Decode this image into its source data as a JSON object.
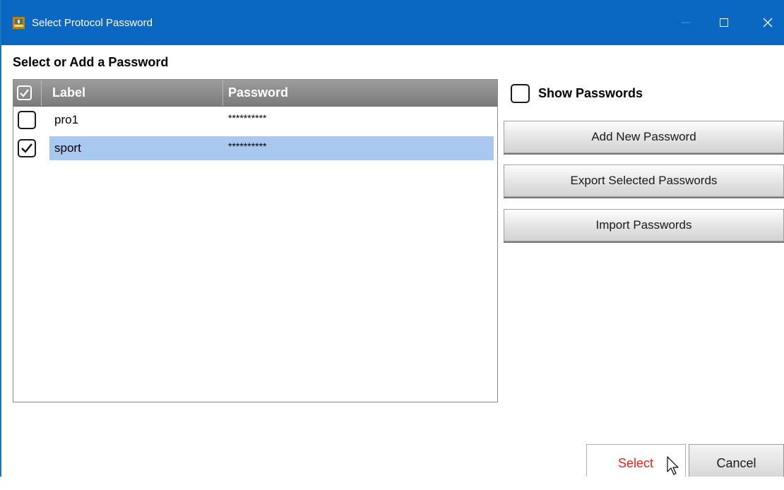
{
  "window": {
    "title": "Select Protocol Password",
    "title_icon": "app-icon",
    "controls": [
      "minimize-icon",
      "maximize-icon",
      "close-icon"
    ]
  },
  "main": {
    "heading": "Select or Add a Password"
  },
  "grid": {
    "columns": [
      "Label",
      "Password"
    ],
    "header_checked": true,
    "rows": [
      {
        "label": "pro1",
        "password": "**********",
        "checked": false,
        "selected": false
      },
      {
        "label": "sport",
        "password": "**********",
        "checked": true,
        "selected": true
      }
    ]
  },
  "options": {
    "show_passwords_label": "Show Passwords",
    "show_passwords_checked": false
  },
  "actions": {
    "add_label": "Add New Password",
    "export_label": "Export Selected Passwords",
    "import_label": "Import Passwords"
  },
  "footer": {
    "select_label": "Select",
    "cancel_label": "Cancel"
  },
  "colors": {
    "titlebar": "#0a67c2",
    "selection": "#a8c8f0",
    "select_text": "#e8231b"
  }
}
